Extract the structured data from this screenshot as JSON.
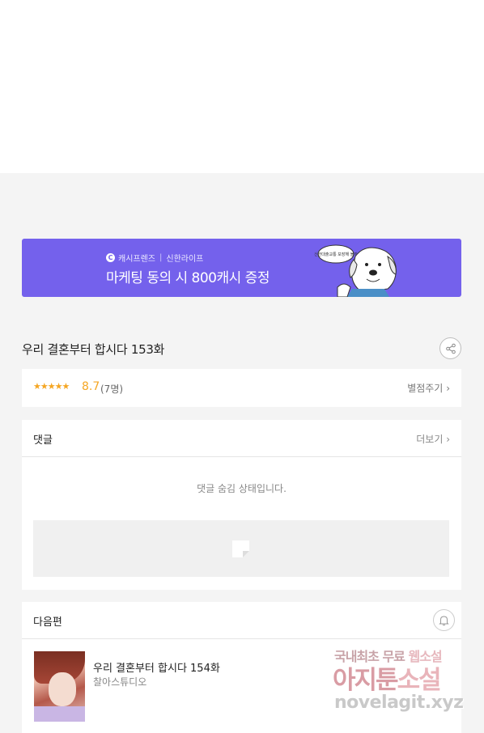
{
  "banner": {
    "brand_left": "캐시프렌즈",
    "brand_right": "신한라이프",
    "headline": "마케팅 동의 시 800캐시 증정",
    "bubble_text": "신한대출교통 보장해 볼까"
  },
  "episode": {
    "title": "우리 결혼부터 합시다 153화"
  },
  "rating": {
    "stars": "★★★★★",
    "score": "8.7",
    "count": "(7명)",
    "rate_label": "별점주기"
  },
  "comments": {
    "label": "댓글",
    "more_label": "더보기",
    "hidden_message": "댓글 숨김 상태입니다."
  },
  "next_episode": {
    "label": "다음편",
    "title": "우리 결혼부터 합시다 154화",
    "studio": "찰아스튜디오"
  },
  "watermark": {
    "line1_a": "국내최초 무료 ",
    "line1_b": "웹소설",
    "line2_a": "아지툰",
    "line2_b": "소설",
    "line3": "novelagit.xyz"
  },
  "colors": {
    "banner_bg": "#7461ec",
    "star": "#f5a623"
  },
  "icons": {
    "share": "share-icon",
    "bell": "bell-icon",
    "chevron": "chevron-right-icon"
  }
}
